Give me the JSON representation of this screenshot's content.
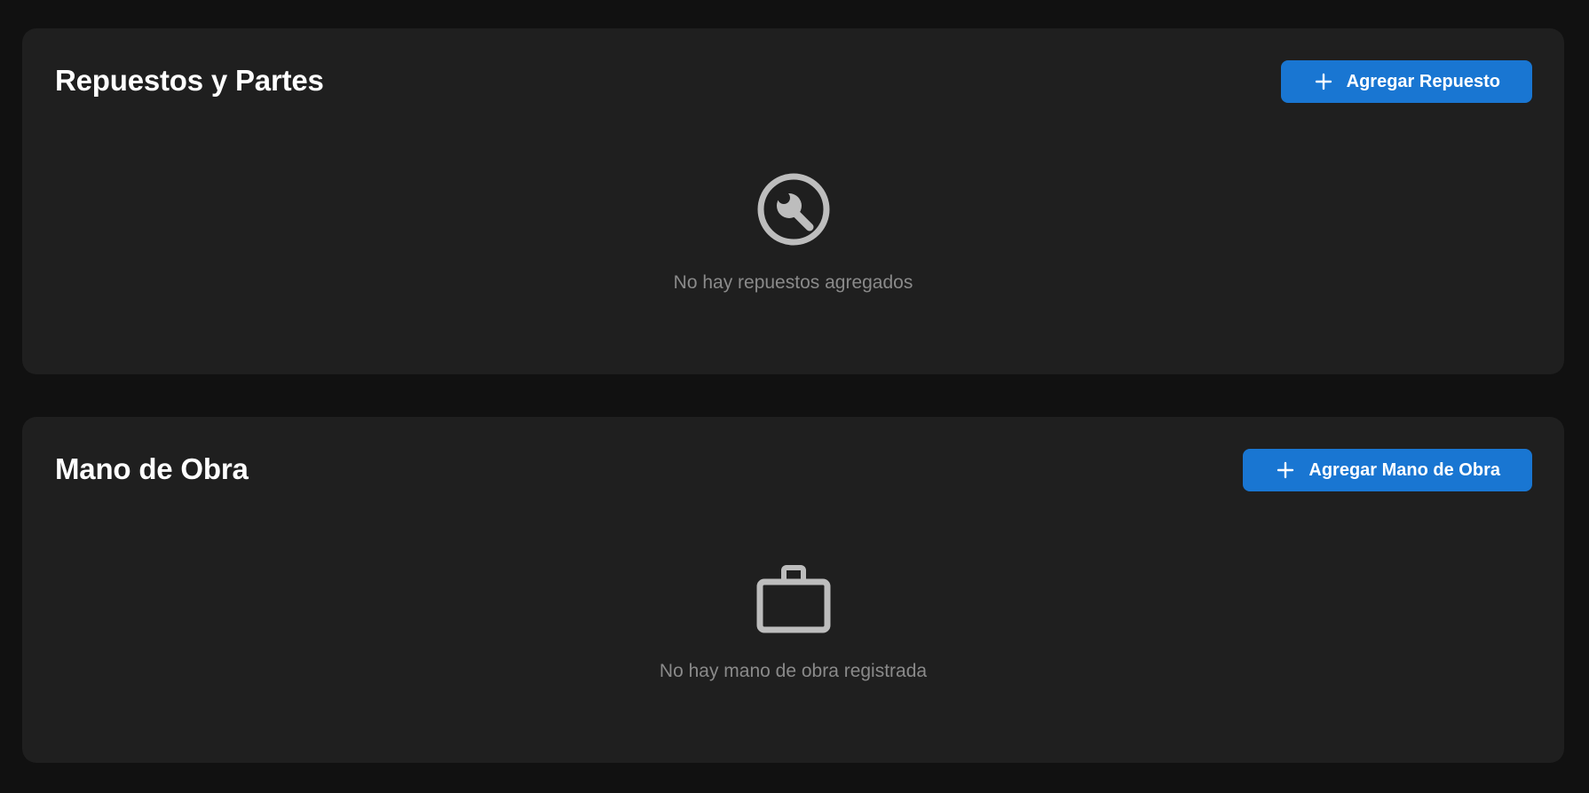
{
  "colors": {
    "background": "#111111",
    "card": "#1f1f1f",
    "accent": "#1976d2",
    "title": "#ffffff",
    "muted_text": "#8a8a8a",
    "icon": "#bdbdbd"
  },
  "sections": {
    "parts": {
      "title": "Repuestos y Partes",
      "add_button_label": "Agregar Repuesto",
      "add_button_icon": "plus-icon",
      "empty_icon": "wrench-icon",
      "empty_text": "No hay repuestos agregados"
    },
    "labor": {
      "title": "Mano de Obra",
      "add_button_label": "Agregar Mano de Obra",
      "add_button_icon": "plus-icon",
      "empty_icon": "briefcase-icon",
      "empty_text": "No hay mano de obra registrada"
    }
  }
}
